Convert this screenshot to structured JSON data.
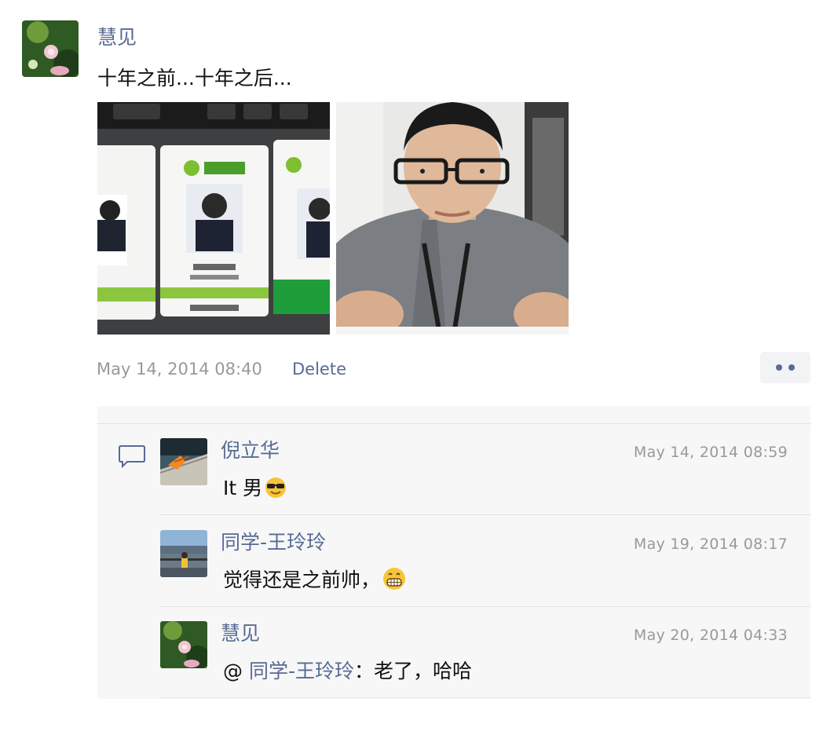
{
  "post": {
    "author": "慧见",
    "text": "十年之前...十年之后...",
    "time": "May 14, 2014 08:40",
    "delete_label": "Delete",
    "photos": [
      {
        "description_icon": "id-badges-photo"
      },
      {
        "description_icon": "selfie-photo"
      }
    ]
  },
  "comments": [
    {
      "author": "倪立华",
      "time": "May 14, 2014 08:59",
      "text": "It 男",
      "emoji": "sunglasses-emoji"
    },
    {
      "author": "同学-王玲玲",
      "time": "May 19, 2014 08:17",
      "text": "觉得还是之前帅，",
      "emoji": "grin-emoji"
    },
    {
      "author": "慧见",
      "time": "May 20, 2014 04:33",
      "mention_prefix": "@ ",
      "mention": "同学-王玲玲",
      "text": "：老了，哈哈"
    }
  ],
  "colors": {
    "link": "#576b95",
    "meta": "#999999",
    "comment_bg": "#f7f7f7"
  }
}
